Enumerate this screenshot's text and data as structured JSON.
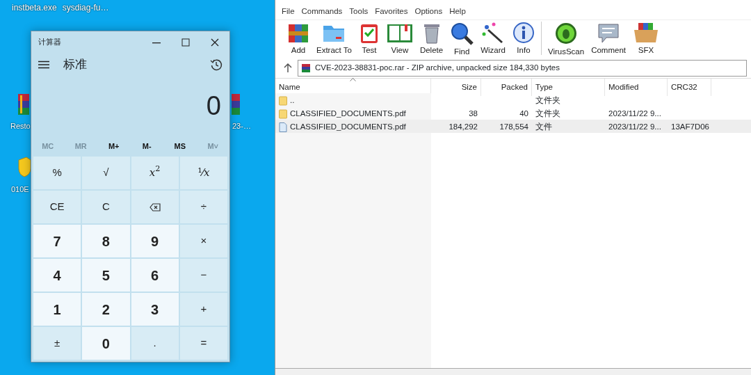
{
  "desktop": {
    "top_labels": [
      "instbeta.exe",
      "sysdiag-fu…"
    ],
    "icons": [
      {
        "label": "Resto",
        "kind": "archive"
      },
      {
        "label": "010E",
        "kind": "shield"
      },
      {
        "label": "23-…",
        "kind": "archive"
      }
    ]
  },
  "calculator": {
    "title": "计算器",
    "mode": "标准",
    "display": "0",
    "memory": [
      {
        "label": "MC",
        "disabled": true
      },
      {
        "label": "MR",
        "disabled": true
      },
      {
        "label": "M+",
        "disabled": false
      },
      {
        "label": "M-",
        "disabled": false
      },
      {
        "label": "MS",
        "disabled": false
      },
      {
        "label": "M˅",
        "disabled": true
      }
    ],
    "keys": [
      {
        "label": "%",
        "kind": "op"
      },
      {
        "label": "√",
        "kind": "op"
      },
      {
        "label": "*x*$^{2}$",
        "kind": "op"
      },
      {
        "label": "¹⁄*x*",
        "kind": "op"
      },
      {
        "label": "CE",
        "kind": "op"
      },
      {
        "label": "C",
        "kind": "op"
      },
      {
        "kind": "backspace"
      },
      {
        "label": "÷",
        "kind": "op"
      },
      {
        "label": "7",
        "kind": "digit"
      },
      {
        "label": "8",
        "kind": "digit"
      },
      {
        "label": "9",
        "kind": "digit"
      },
      {
        "label": "×",
        "kind": "op"
      },
      {
        "label": "4",
        "kind": "digit"
      },
      {
        "label": "5",
        "kind": "digit"
      },
      {
        "label": "6",
        "kind": "digit"
      },
      {
        "label": "−",
        "kind": "op"
      },
      {
        "label": "1",
        "kind": "digit"
      },
      {
        "label": "2",
        "kind": "digit"
      },
      {
        "label": "3",
        "kind": "digit"
      },
      {
        "label": "+",
        "kind": "op"
      },
      {
        "label": "±",
        "kind": "op"
      },
      {
        "label": "0",
        "kind": "digit"
      },
      {
        "label": ".",
        "kind": "op"
      },
      {
        "label": "=",
        "kind": "op"
      }
    ]
  },
  "archiver": {
    "menu": [
      "File",
      "Commands",
      "Tools",
      "Favorites",
      "Options",
      "Help"
    ],
    "toolbar": [
      {
        "label": "Add"
      },
      {
        "label": "Extract To"
      },
      {
        "label": "Test"
      },
      {
        "label": "View"
      },
      {
        "label": "Delete"
      },
      {
        "label": "Find"
      },
      {
        "label": "Wizard"
      },
      {
        "label": "Info"
      },
      {
        "label": "VirusScan"
      },
      {
        "label": "Comment"
      },
      {
        "label": "SFX"
      }
    ],
    "address": "CVE-2023-38831-poc.rar - ZIP archive, unpacked size 184,330 bytes",
    "columns": [
      "Name",
      "Size",
      "Packed",
      "Type",
      "Modified",
      "CRC32"
    ],
    "rows": [
      {
        "kind": "folder",
        "selected": false,
        "cells": [
          "..",
          "",
          "",
          "文件夹",
          "",
          ""
        ]
      },
      {
        "kind": "folder",
        "selected": false,
        "cells": [
          "CLASSIFIED_DOCUMENTS.pdf",
          "38",
          "40",
          "文件夹",
          "2023/11/22 9...",
          ""
        ]
      },
      {
        "kind": "file",
        "selected": true,
        "cells": [
          "CLASSIFIED_DOCUMENTS.pdf",
          "184,292",
          "178,554",
          "文件",
          "2023/11/22 9...",
          "13AF7D06"
        ]
      }
    ]
  }
}
